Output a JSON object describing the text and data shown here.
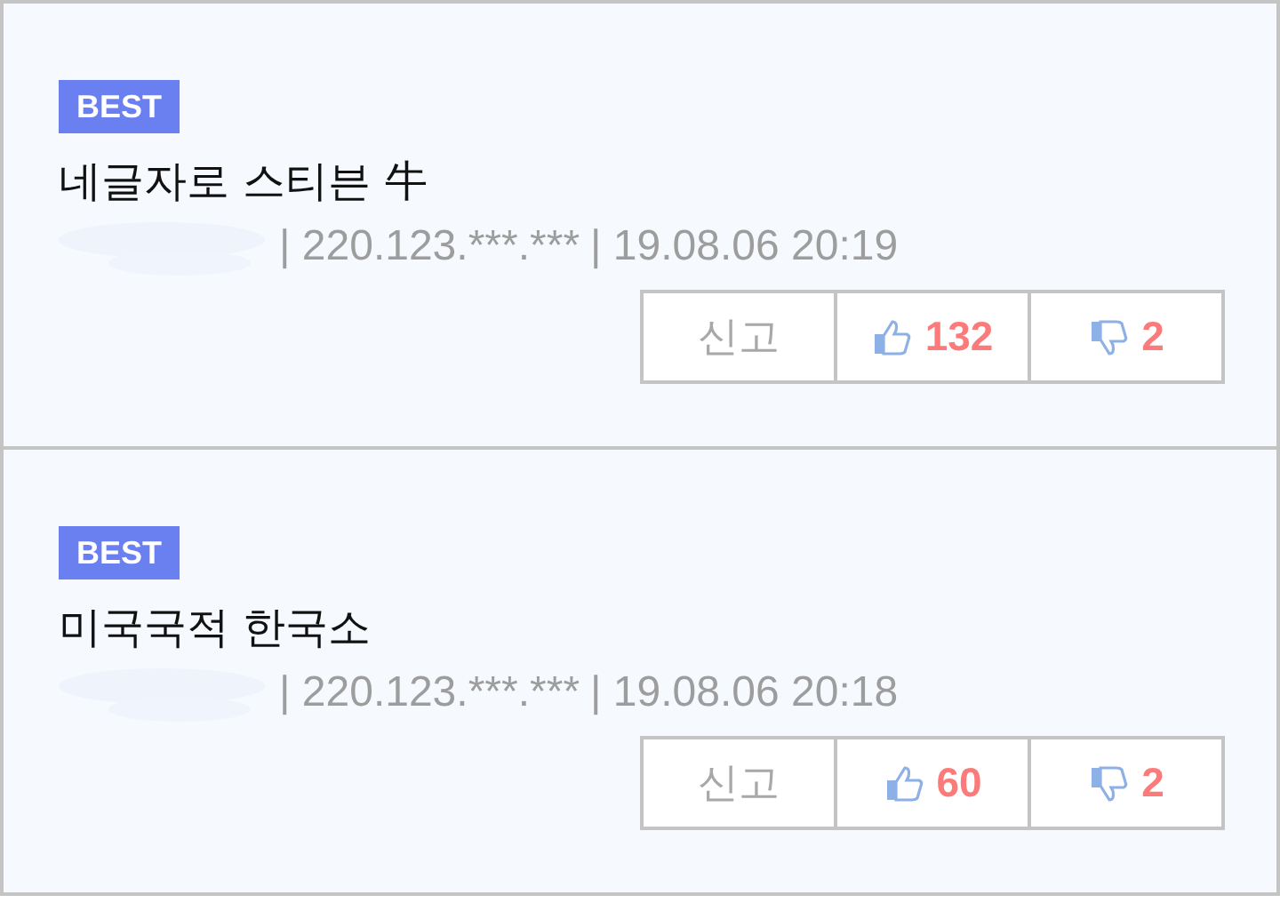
{
  "comments": [
    {
      "badge": "BEST",
      "text": "네글자로 스티븐 牛",
      "ip": "| 220.123.***.***",
      "time": "| 19.08.06 20:19",
      "report": "신고",
      "likes": "132",
      "dislikes": "2"
    },
    {
      "badge": "BEST",
      "text": "미국국적 한국소",
      "ip": "| 220.123.***.***",
      "time": "| 19.08.06 20:18",
      "report": "신고",
      "likes": "60",
      "dislikes": "2"
    }
  ]
}
